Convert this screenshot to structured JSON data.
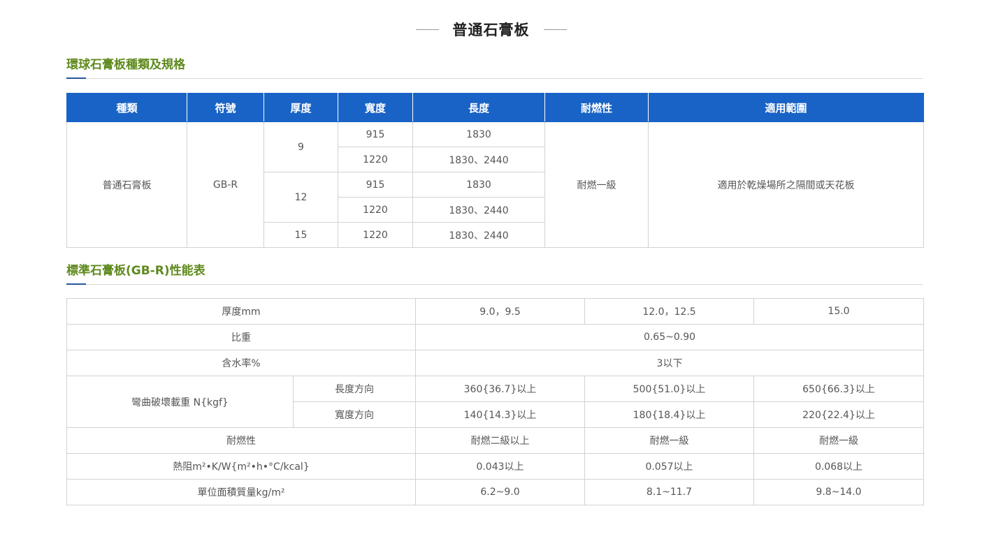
{
  "page_title": "普通石膏板",
  "section1": {
    "title": "環球石膏板種類及規格",
    "headers": [
      "種類",
      "符號",
      "厚度",
      "寬度",
      "長度",
      "耐燃性",
      "適用範圍"
    ],
    "type": "普通石膏板",
    "symbol": "GB-R",
    "thickness": [
      "9",
      "12",
      "15"
    ],
    "rows": [
      {
        "width": "915",
        "length": "1830"
      },
      {
        "width": "1220",
        "length": "1830、2440"
      },
      {
        "width": "915",
        "length": "1830"
      },
      {
        "width": "1220",
        "length": "1830、2440"
      },
      {
        "width": "1220",
        "length": "1830、2440"
      }
    ],
    "fire": "耐燃一級",
    "scope": "適用於乾燥場所之隔間或天花板"
  },
  "section2": {
    "title": "標準石膏板(GB-R)性能表",
    "rows": {
      "thickness": {
        "label": "厚度mm",
        "values": [
          "9.0，9.5",
          "12.0，12.5",
          "15.0"
        ]
      },
      "gravity": {
        "label": "比重",
        "value": "0.65~0.90"
      },
      "moisture": {
        "label": "含水率%",
        "value": "3以下"
      },
      "bending": {
        "label": "彎曲破壞載重 N{kgf}",
        "length": {
          "label": "長度方向",
          "values": [
            "360{36.7}以上",
            "500{51.0}以上",
            "650{66.3}以上"
          ]
        },
        "width": {
          "label": "寬度方向",
          "values": [
            "140{14.3}以上",
            "180{18.4}以上",
            "220{22.4}以上"
          ]
        }
      },
      "fire": {
        "label": "耐燃性",
        "values": [
          "耐燃二級以上",
          "耐燃一級",
          "耐燃一級"
        ]
      },
      "thermal": {
        "label": "熱阻m²•K/W{m²•h•°C/kcal}",
        "values": [
          "0.043以上",
          "0.057以上",
          "0.068以上"
        ]
      },
      "mass": {
        "label": "單位面積質量kg/m²",
        "values": [
          "6.2~9.0",
          "8.1~11.7",
          "9.8~14.0"
        ]
      }
    }
  }
}
